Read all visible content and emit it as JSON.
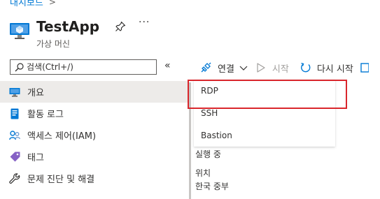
{
  "breadcrumb": {
    "label": "대시보드",
    "separator": ">"
  },
  "header": {
    "title": "TestApp",
    "subtitle": "가상 머신",
    "more": "···"
  },
  "search": {
    "placeholder": "검색(Ctrl+/)"
  },
  "collapse_label": "«",
  "sidebar": {
    "items": [
      {
        "label": "개요",
        "icon": "vm-monitor-icon"
      },
      {
        "label": "활동 로그",
        "icon": "activity-log-icon"
      },
      {
        "label": "액세스 제어(IAM)",
        "icon": "people-icon"
      },
      {
        "label": "태그",
        "icon": "tag-icon"
      },
      {
        "label": "문제 진단 및 해결",
        "icon": "wrench-icon"
      }
    ]
  },
  "toolbar": {
    "connect_label": "연결",
    "start_label": "시작",
    "restart_label": "다시 시작"
  },
  "dropdown": {
    "items": [
      "RDP",
      "SSH",
      "Bastion"
    ]
  },
  "essentials": {
    "status_value": "실행 중",
    "location_label": "위치",
    "location_value": "한국 중부"
  },
  "colors": {
    "accent": "#0078d4",
    "highlight": "#d9262c",
    "active_bg": "#edebe9",
    "disabled": "#a19f9d"
  }
}
